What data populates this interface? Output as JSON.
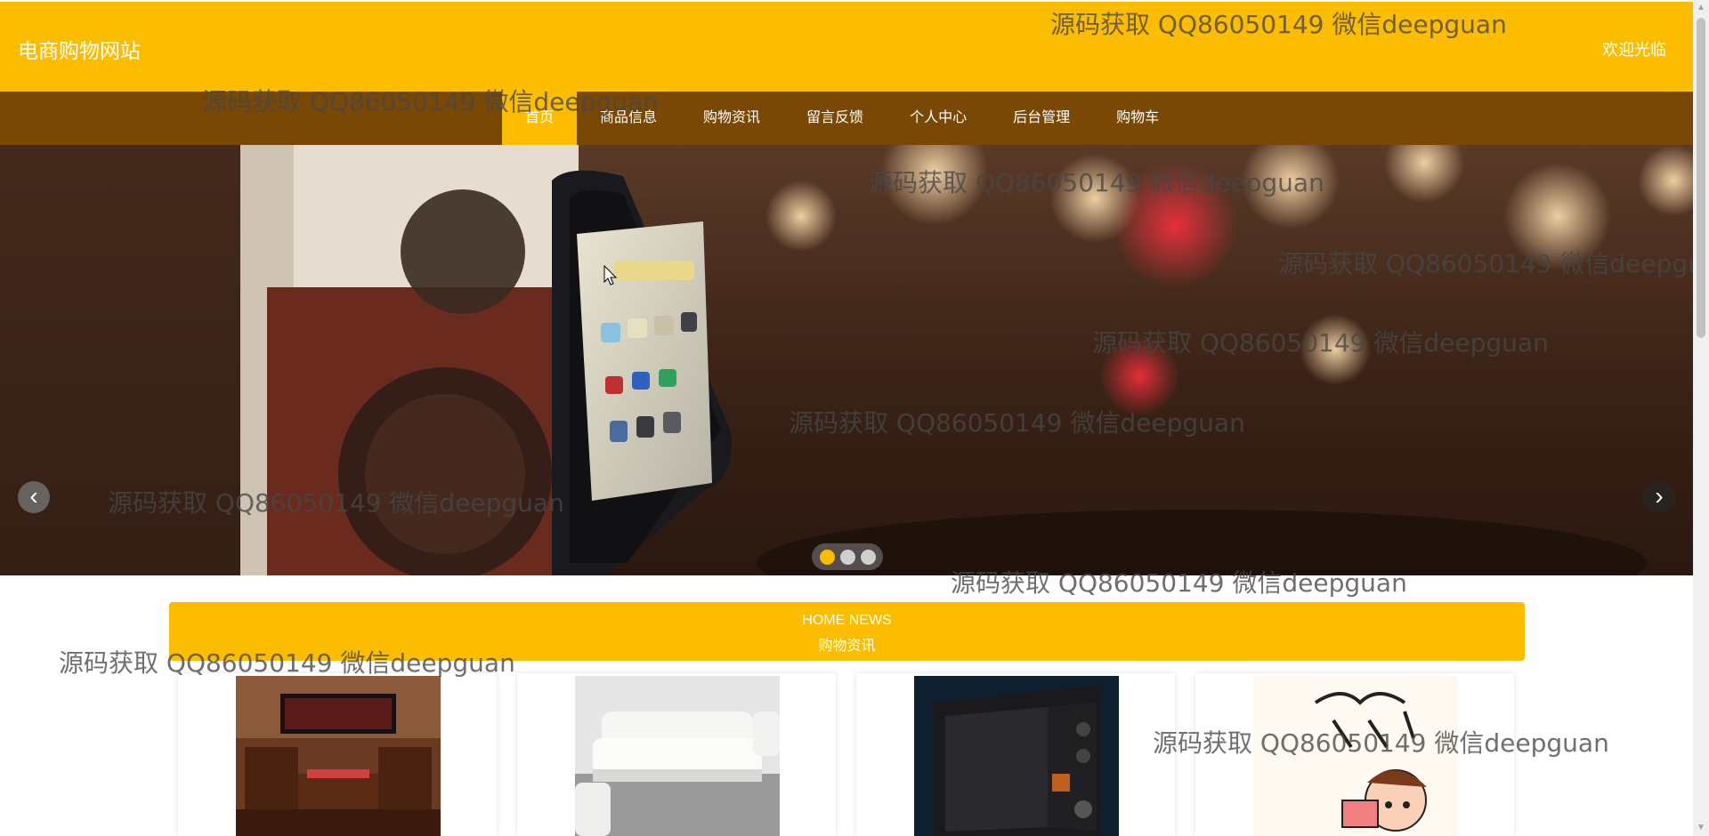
{
  "header": {
    "site_title": "电商购物网站",
    "welcome": "欢迎光临"
  },
  "nav": {
    "items": [
      {
        "label": "首页",
        "active": true
      },
      {
        "label": "商品信息"
      },
      {
        "label": "购物资讯"
      },
      {
        "label": "留言反馈"
      },
      {
        "label": "个人中心"
      },
      {
        "label": "后台管理"
      },
      {
        "label": "购物车"
      }
    ]
  },
  "banner": {
    "slide_count": 3,
    "active_slide": 1,
    "prev_icon": "chevron-left-icon",
    "next_icon": "chevron-right-icon",
    "prev_glyph": "‹",
    "next_glyph": "›"
  },
  "news": {
    "title_en": "HOME NEWS",
    "title_cn": "购物资讯"
  },
  "watermark": "源码获取 QQ86050149 微信deepguan",
  "colors": {
    "header_bg": "#fcbc00",
    "nav_bg": "#7a4805",
    "accent": "#fcbc00"
  }
}
